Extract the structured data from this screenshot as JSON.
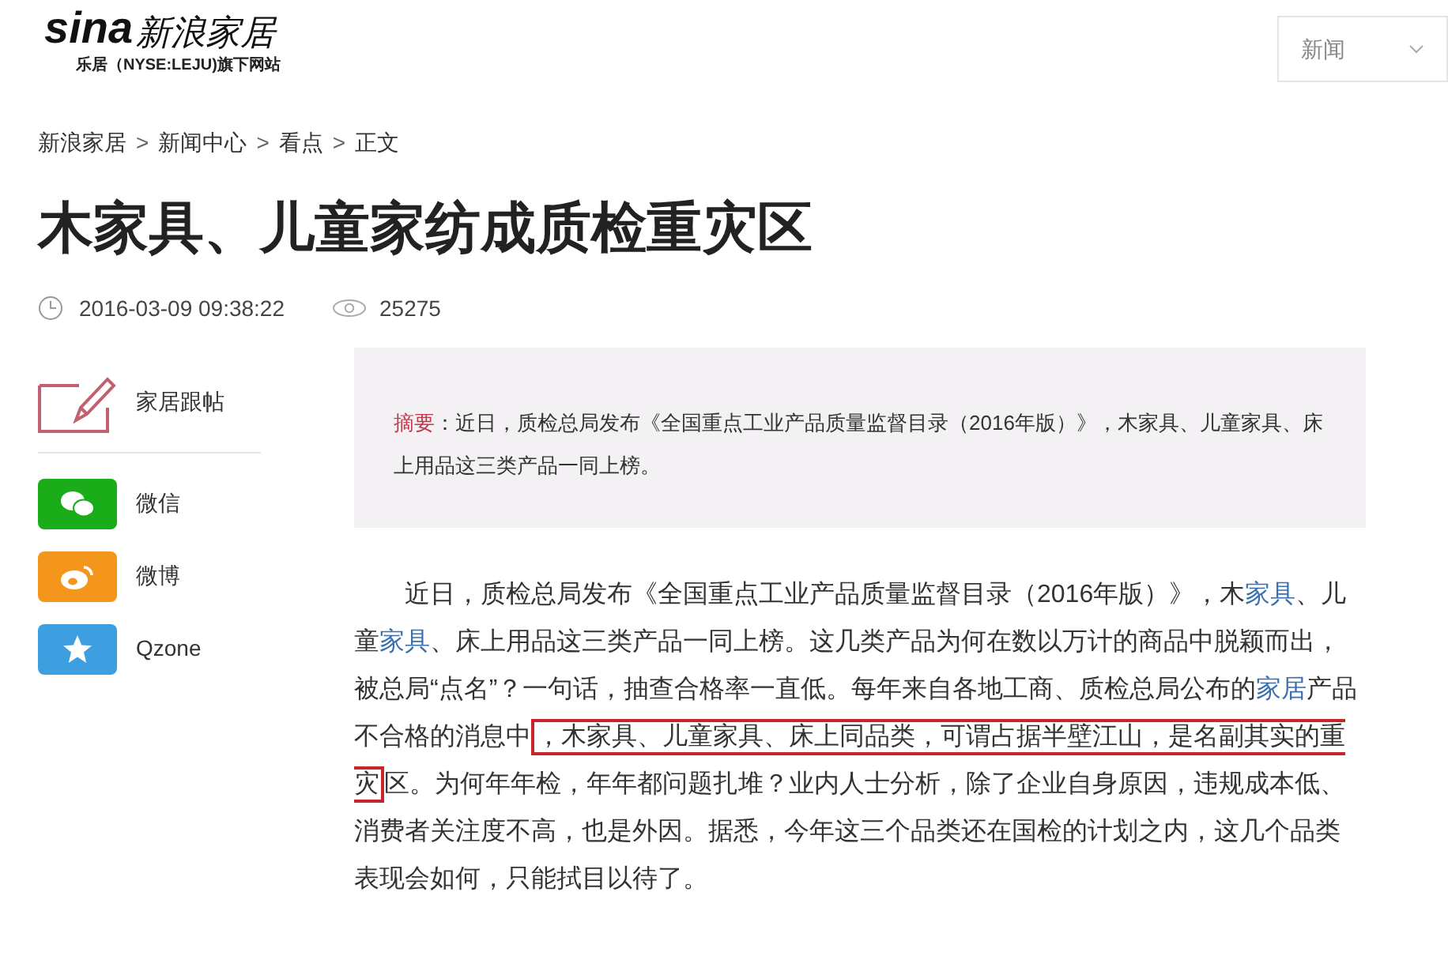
{
  "logo": {
    "wordmark": "sina",
    "name": "新浪家居",
    "subtitle": "乐居（NYSE:LEJU)旗下网站"
  },
  "channel_select": {
    "value": "新闻"
  },
  "breadcrumb": [
    {
      "label": "新浪家居",
      "separator": ">"
    },
    {
      "label": "新闻中心",
      "separator": ">"
    },
    {
      "label": "看点",
      "separator": ">"
    },
    {
      "label": "正文"
    }
  ],
  "article": {
    "title": "木家具、儿童家纺成质检重灾区",
    "date": "2016-03-09 09:38:22",
    "views": "25275",
    "summary": {
      "label": "摘要",
      "text": "：近日，质检总局发布《全国重点工业产品质量监督目录（2016年版）》，木家具、儿童家具、床上用品这三类产品一同上榜。"
    },
    "body": [
      {
        "kind": "text",
        "text": "近日，质检总局发布《全国重点工业产品质量监督目录（2016年版）》，木"
      },
      {
        "kind": "link",
        "text": "家具"
      },
      {
        "kind": "text",
        "text": "、儿童"
      },
      {
        "kind": "link",
        "text": "家具"
      },
      {
        "kind": "text",
        "text": "、床上用品这三类产品一同上榜。这几类产品为何在数以万计的商品中脱颖而出，被总局“点名”？一句话，抽查合格率一直低。每年来自各地工商、质检总局公布的"
      },
      {
        "kind": "link",
        "text": "家居"
      },
      {
        "kind": "text",
        "text": "产品不合格的消息中"
      },
      {
        "kind": "highlight",
        "text": "，木家具、儿童家具、床上同品类，可谓占据半壁江山，是名副其实的重灾"
      },
      {
        "kind": "text",
        "text": "区。为何年年检，年年都问题扎堆？业内人士分析，除了企业自身原因，违规成本低、消费者关注度不高，也是外因。据悉，今年这三个品类还在国检的计划之内，这几个品类表现会如何，只能拭目以待了。"
      }
    ]
  },
  "sidebar": {
    "comment": {
      "label": "家居跟帖"
    },
    "share": [
      {
        "kind": "wechat",
        "label": "微信",
        "color": "#1aad19"
      },
      {
        "kind": "weibo",
        "label": "微博",
        "color": "#f4961c"
      },
      {
        "kind": "qzone",
        "label": "Qzone",
        "color": "#3d9ee0"
      }
    ]
  }
}
